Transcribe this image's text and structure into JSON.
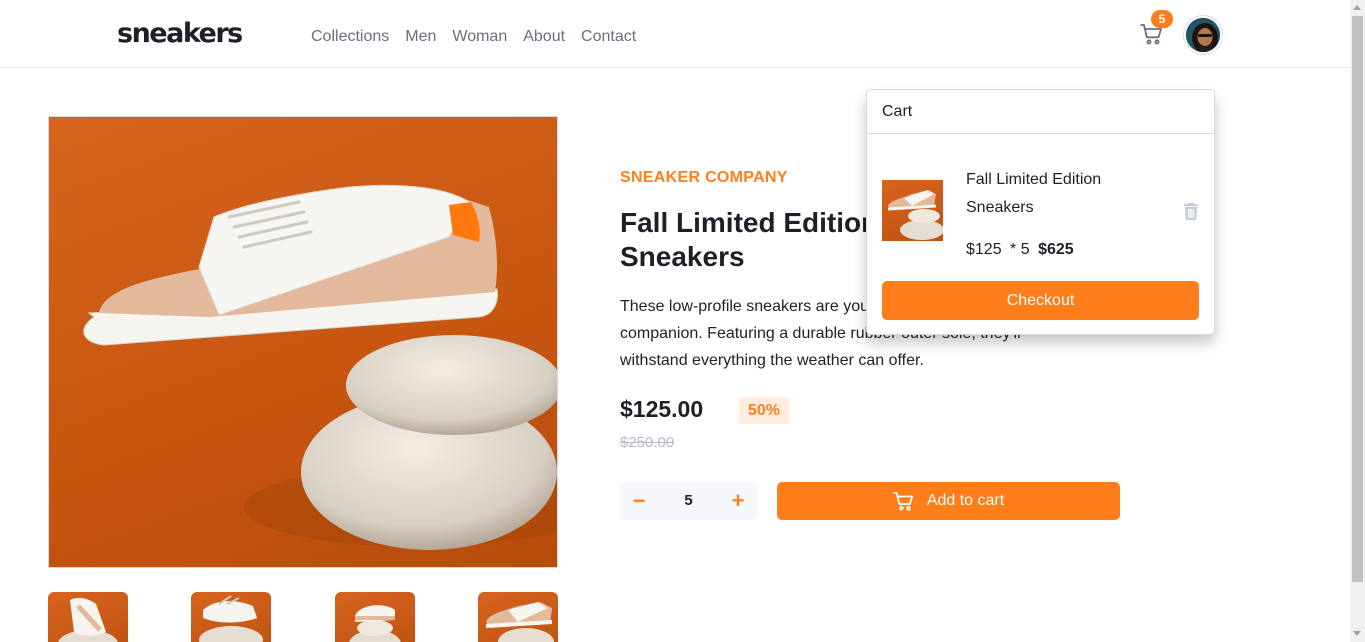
{
  "header": {
    "logo": "sneakers",
    "nav": [
      "Collections",
      "Men",
      "Woman",
      "About",
      "Contact"
    ],
    "cart_count": "5"
  },
  "product": {
    "company": "SNEAKER COMPANY",
    "title": "Fall Limited Edition Sneakers",
    "description": "These low-profile sneakers are your perfect casual wear companion. Featuring a durable rubber outer sole, they'll withstand everything the weather can offer.",
    "price": "$125.00",
    "discount": "50%",
    "old_price": "$250.00",
    "quantity": "5",
    "minus_label": "−",
    "plus_label": "+",
    "add_to_cart": "Add to cart"
  },
  "cart": {
    "title": "Cart",
    "item_name": "Fall Limited Edition Sneakers",
    "item_unit_price": "$125",
    "item_multiplier": "* 5",
    "item_total": "$625",
    "checkout_label": "Checkout"
  },
  "colors": {
    "accent": "#ff7e1b",
    "accent_pale": "#ffede0",
    "text_dark": "#1d2026",
    "text_grey": "#69707d"
  },
  "icons": {
    "cart": "cart-icon",
    "trash": "trash-icon",
    "avatar": "avatar"
  }
}
